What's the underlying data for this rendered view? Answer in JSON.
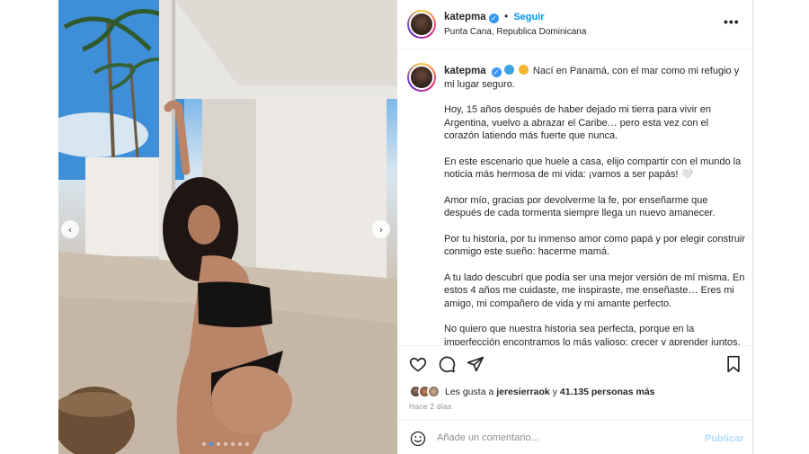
{
  "post": {
    "username": "katepma",
    "follow_label": "Seguir",
    "separator": "•",
    "location": "Punta Cana, Republica Dominicana",
    "more_label": "•••"
  },
  "caption": {
    "paragraphs": [
      "Nací en Panamá, con el mar como mi refugio y mi lugar seguro.",
      "Hoy, 15 años después de haber dejado mi tierra para vivir en Argentina, vuelvo a abrazar el Caribe… pero esta vez con el corazón latiendo más fuerte que nunca.",
      "En este escenario que huele a casa, elijo compartir con el mundo la noticia más hermosa de mi vida: ¡vamos a ser papás! 🤍",
      "Amor mío, gracias por devolverme la fe, por enseñarme que después de cada tormenta siempre llega un nuevo amanecer.",
      "Por tu historia, por tu inmenso amor como papá y por elegir construir conmigo este sueño: hacerme mamá.",
      "A tu lado descubrí que podía ser una mejor versión de mí misma. En estos 4 años me cuidaste, me inspiraste, me enseñaste… Eres mi amigo, mi compañero de vida y mi amante perfecto.",
      "No quiero que nuestra historia sea perfecta, porque en la imperfección encontramos lo más valioso: crecer y aprender juntos."
    ]
  },
  "engagement": {
    "likes_prefix": "Les gusta a",
    "liked_by": "jeresierraok",
    "likes_joiner": "y",
    "others_count": "41.135 personas más",
    "time_ago": "Hace 2 días"
  },
  "comment": {
    "placeholder": "Añade un comentario...",
    "publish_label": "Publicar"
  },
  "carousel": {
    "prev_label": "‹",
    "next_label": "›",
    "dots_total": 7,
    "active_dot": 1
  },
  "colors": {
    "accent": "#0095f6",
    "verified": "#3897f0",
    "publish_disabled": "#b3dbff"
  },
  "icons": [
    "heart-icon",
    "comment-icon",
    "share-icon",
    "bookmark-icon",
    "emoji-icon",
    "verified-icon"
  ]
}
